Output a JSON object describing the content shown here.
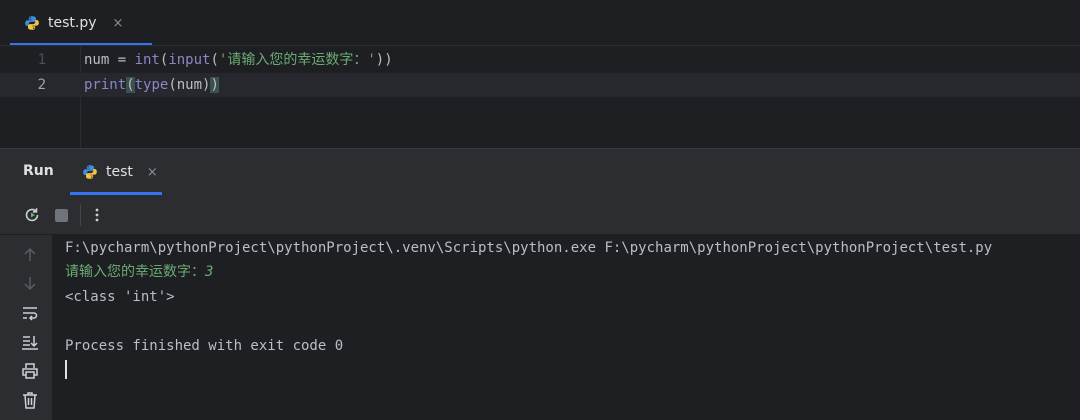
{
  "editor": {
    "tab": {
      "label": "test.py",
      "close": "×",
      "icon": "python-file-icon"
    },
    "lines": [
      {
        "number": "1",
        "tokens": [
          {
            "t": "num = ",
            "cls": ""
          },
          {
            "t": "int",
            "cls": "c-builtin"
          },
          {
            "t": "(",
            "cls": ""
          },
          {
            "t": "input",
            "cls": "c-builtin"
          },
          {
            "t": "(",
            "cls": ""
          },
          {
            "t": "'请输入您的幸运数字：'",
            "cls": "c-str"
          },
          {
            "t": "))",
            "cls": ""
          }
        ]
      },
      {
        "number": "2",
        "tokens": [
          {
            "t": "print",
            "cls": "c-builtin"
          },
          {
            "t": "(",
            "cls": "c-paren-hl"
          },
          {
            "t": "type",
            "cls": "c-builtin"
          },
          {
            "t": "(num)",
            "cls": ""
          },
          {
            "t": ")",
            "cls": "c-paren-hl"
          }
        ]
      }
    ]
  },
  "run": {
    "title": "Run",
    "tab": {
      "label": "test",
      "close": "×",
      "icon": "python-run-icon"
    },
    "toolbar": [
      "rerun-icon",
      "stop-icon",
      "more-options-icon"
    ],
    "side_toolbar": [
      "scroll-up-icon",
      "scroll-down-icon",
      "soft-wrap-icon",
      "scroll-to-end-icon",
      "print-icon",
      "clear-all-icon"
    ],
    "console": {
      "command": "F:\\pycharm\\pythonProject\\pythonProject\\.venv\\Scripts\\python.exe F:\\pycharm\\pythonProject\\pythonProject\\test.py",
      "prompt": "请输入您的幸运数字：",
      "user_input": "3",
      "output": "<class 'int'>",
      "exit": "Process finished with exit code 0"
    }
  },
  "colors": {
    "background": "#1e1f22",
    "panel": "#2b2d30",
    "accent": "#3574f0",
    "string": "#6aab73",
    "builtin": "#8888c6"
  }
}
